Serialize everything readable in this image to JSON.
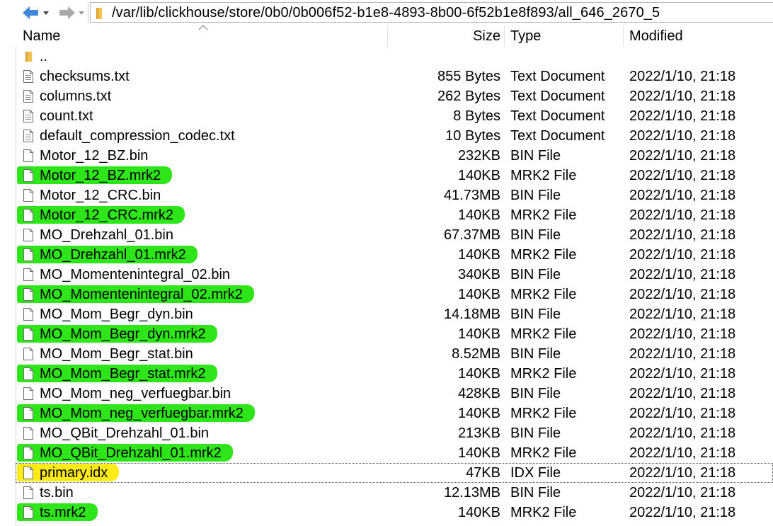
{
  "address": {
    "path": "/var/lib/clickhouse/store/0b0/0b006f52-b1e8-4893-8b00-6f52b1e8f893/all_646_2670_5"
  },
  "columns": {
    "name": "Name",
    "size": "Size",
    "type": "Type",
    "modified": "Modified"
  },
  "colors": {
    "highlight_green": "#2ee51a",
    "highlight_yellow": "#ffeb15",
    "back_arrow": "#3d86d8",
    "folder": "#f2c14e"
  },
  "files": [
    {
      "name": "..",
      "size": "",
      "type": "",
      "modified": "",
      "icon": "folder-icon",
      "highlight": ""
    },
    {
      "name": "checksums.txt",
      "size": "855 Bytes",
      "type": "Text Document",
      "modified": "2022/1/10, 21:18",
      "icon": "text-file-icon",
      "highlight": ""
    },
    {
      "name": "columns.txt",
      "size": "262 Bytes",
      "type": "Text Document",
      "modified": "2022/1/10, 21:18",
      "icon": "text-file-icon",
      "highlight": ""
    },
    {
      "name": "count.txt",
      "size": "8 Bytes",
      "type": "Text Document",
      "modified": "2022/1/10, 21:18",
      "icon": "text-file-icon",
      "highlight": ""
    },
    {
      "name": "default_compression_codec.txt",
      "size": "10 Bytes",
      "type": "Text Document",
      "modified": "2022/1/10, 21:18",
      "icon": "text-file-icon",
      "highlight": ""
    },
    {
      "name": "Motor_12_BZ.bin",
      "size": "232KB",
      "type": "BIN File",
      "modified": "2022/1/10, 21:18",
      "icon": "file-icon",
      "highlight": ""
    },
    {
      "name": "Motor_12_BZ.mrk2",
      "size": "140KB",
      "type": "MRK2 File",
      "modified": "2022/1/10, 21:18",
      "icon": "file-icon",
      "highlight": "green"
    },
    {
      "name": "Motor_12_CRC.bin",
      "size": "41.73MB",
      "type": "BIN File",
      "modified": "2022/1/10, 21:18",
      "icon": "file-icon",
      "highlight": ""
    },
    {
      "name": "Motor_12_CRC.mrk2",
      "size": "140KB",
      "type": "MRK2 File",
      "modified": "2022/1/10, 21:18",
      "icon": "file-icon",
      "highlight": "green"
    },
    {
      "name": "MO_Drehzahl_01.bin",
      "size": "67.37MB",
      "type": "BIN File",
      "modified": "2022/1/10, 21:18",
      "icon": "file-icon",
      "highlight": ""
    },
    {
      "name": "MO_Drehzahl_01.mrk2",
      "size": "140KB",
      "type": "MRK2 File",
      "modified": "2022/1/10, 21:18",
      "icon": "file-icon",
      "highlight": "green"
    },
    {
      "name": "MO_Momentenintegral_02.bin",
      "size": "340KB",
      "type": "BIN File",
      "modified": "2022/1/10, 21:18",
      "icon": "file-icon",
      "highlight": ""
    },
    {
      "name": "MO_Momentenintegral_02.mrk2",
      "size": "140KB",
      "type": "MRK2 File",
      "modified": "2022/1/10, 21:18",
      "icon": "file-icon",
      "highlight": "green"
    },
    {
      "name": "MO_Mom_Begr_dyn.bin",
      "size": "14.18MB",
      "type": "BIN File",
      "modified": "2022/1/10, 21:18",
      "icon": "file-icon",
      "highlight": ""
    },
    {
      "name": "MO_Mom_Begr_dyn.mrk2",
      "size": "140KB",
      "type": "MRK2 File",
      "modified": "2022/1/10, 21:18",
      "icon": "file-icon",
      "highlight": "green"
    },
    {
      "name": "MO_Mom_Begr_stat.bin",
      "size": "8.52MB",
      "type": "BIN File",
      "modified": "2022/1/10, 21:18",
      "icon": "file-icon",
      "highlight": ""
    },
    {
      "name": "MO_Mom_Begr_stat.mrk2",
      "size": "140KB",
      "type": "MRK2 File",
      "modified": "2022/1/10, 21:18",
      "icon": "file-icon",
      "highlight": "green"
    },
    {
      "name": "MO_Mom_neg_verfuegbar.bin",
      "size": "428KB",
      "type": "BIN File",
      "modified": "2022/1/10, 21:18",
      "icon": "file-icon",
      "highlight": ""
    },
    {
      "name": "MO_Mom_neg_verfuegbar.mrk2",
      "size": "140KB",
      "type": "MRK2 File",
      "modified": "2022/1/10, 21:18",
      "icon": "file-icon",
      "highlight": "green"
    },
    {
      "name": "MO_QBit_Drehzahl_01.bin",
      "size": "213KB",
      "type": "BIN File",
      "modified": "2022/1/10, 21:18",
      "icon": "file-icon",
      "highlight": ""
    },
    {
      "name": "MO_QBit_Drehzahl_01.mrk2",
      "size": "140KB",
      "type": "MRK2 File",
      "modified": "2022/1/10, 21:18",
      "icon": "file-icon",
      "highlight": "green"
    },
    {
      "name": "primary.idx",
      "size": "47KB",
      "type": "IDX File",
      "modified": "2022/1/10, 21:18",
      "icon": "file-icon",
      "highlight": "yellow",
      "focused": true
    },
    {
      "name": "ts.bin",
      "size": "12.13MB",
      "type": "BIN File",
      "modified": "2022/1/10, 21:18",
      "icon": "file-icon",
      "highlight": ""
    },
    {
      "name": "ts.mrk2",
      "size": "140KB",
      "type": "MRK2 File",
      "modified": "2022/1/10, 21:18",
      "icon": "file-icon",
      "highlight": "green"
    }
  ]
}
